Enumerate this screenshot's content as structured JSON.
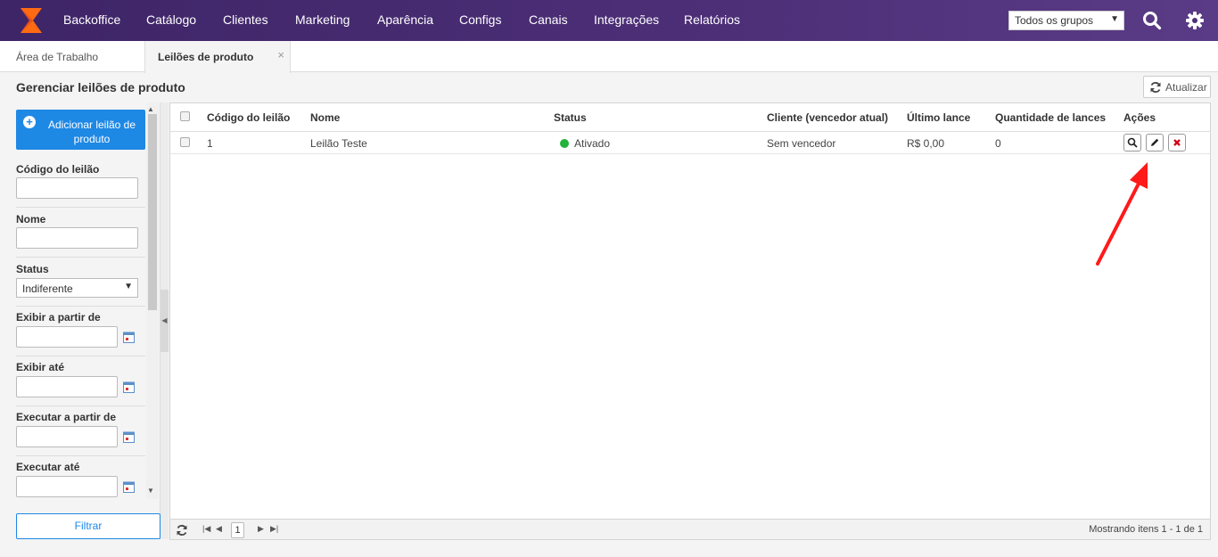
{
  "topbar": {
    "nav": [
      "Backoffice",
      "Catálogo",
      "Clientes",
      "Marketing",
      "Aparência",
      "Configs",
      "Canais",
      "Integrações",
      "Relatórios"
    ],
    "group_select": "Todos os grupos",
    "colors": {
      "bar": "#4d2f78",
      "logo_orange": "#ff6a13",
      "accent": "#1e88e5",
      "status_active": "#22b33a",
      "delete": "#d0021b",
      "annotation_arrow": "#ff1a1a"
    }
  },
  "tabs": {
    "workspace": "Área de Trabalho",
    "active": "Leilões de produto",
    "close": "×"
  },
  "page": {
    "title": "Gerenciar leilões de produto",
    "refresh_label": "Atualizar"
  },
  "sidebar": {
    "add_button": "Adicionar leilão de produto",
    "filters": {
      "code_label": "Código do leilão",
      "name_label": "Nome",
      "status_label": "Status",
      "status_value": "Indiferente",
      "show_from_label": "Exibir a partir de",
      "show_until_label": "Exibir até",
      "run_from_label": "Executar a partir de",
      "run_until_label": "Executar até"
    },
    "filter_button": "Filtrar"
  },
  "grid": {
    "columns": [
      "Código do leilão",
      "Nome",
      "Status",
      "Cliente (vencedor atual)",
      "Último lance",
      "Quantidade de lances",
      "Ações"
    ],
    "rows": [
      {
        "code": "1",
        "name": "Leilão Teste",
        "status": "Ativado",
        "client": "Sem vencedor",
        "last_bid": "R$ 0,00",
        "bid_count": "0"
      }
    ],
    "pager": {
      "page": "1",
      "showing": "Mostrando itens 1 - 1 de 1"
    }
  },
  "icons": [
    "logo-icon",
    "search-icon",
    "gear-icon",
    "refresh-icon",
    "plus-icon",
    "calendar-icon",
    "view-icon",
    "edit-icon",
    "delete-icon",
    "first-page-icon",
    "prev-page-icon",
    "next-page-icon",
    "last-page-icon",
    "reload-icon",
    "annotation-arrow"
  ]
}
